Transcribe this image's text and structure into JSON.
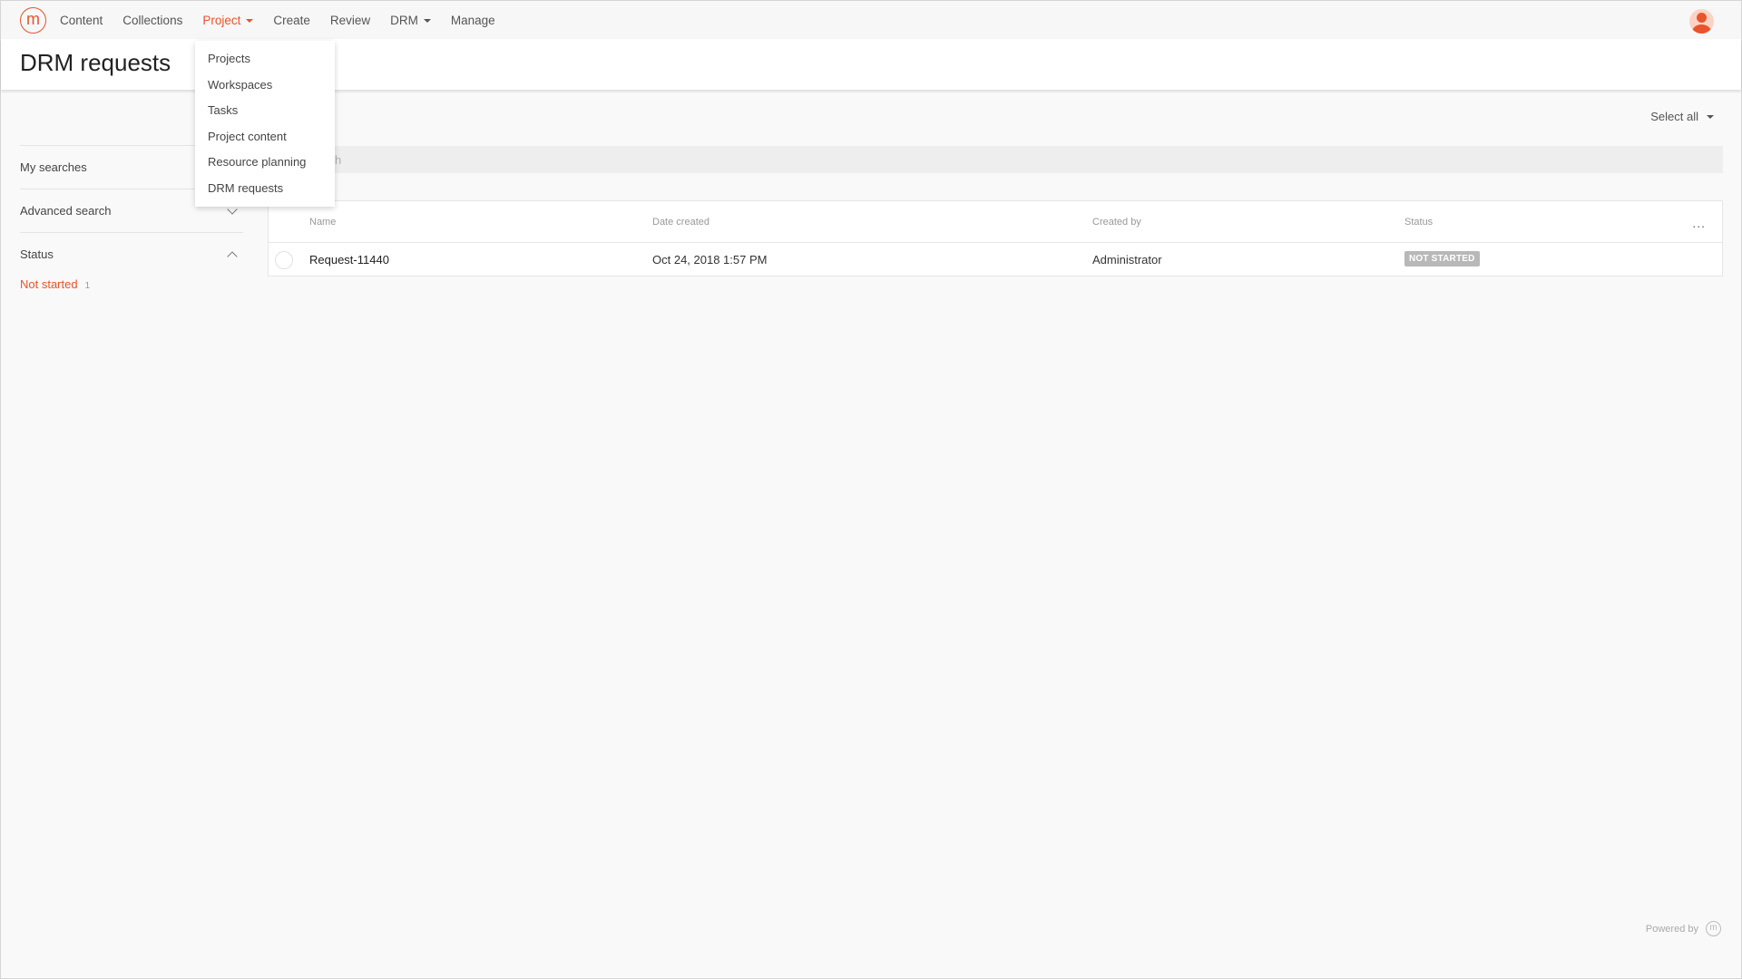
{
  "nav": {
    "logo_letter": "m",
    "items": [
      {
        "label": "Content"
      },
      {
        "label": "Collections"
      },
      {
        "label": "Project",
        "active": true,
        "has_caret": true
      },
      {
        "label": "Create"
      },
      {
        "label": "Review"
      },
      {
        "label": "DRM",
        "has_caret": true
      },
      {
        "label": "Manage"
      }
    ],
    "avatar_icon": "user-avatar-icon"
  },
  "page": {
    "title": "DRM requests"
  },
  "dropdown": {
    "items": [
      {
        "label": "Projects"
      },
      {
        "label": "Workspaces"
      },
      {
        "label": "Tasks"
      },
      {
        "label": "Project content"
      },
      {
        "label": "Resource planning"
      },
      {
        "label": "DRM requests"
      }
    ]
  },
  "sidebar": {
    "my_searches": "My searches",
    "advanced_search": "Advanced search",
    "status_label": "Status",
    "facets": [
      {
        "label": "Not started",
        "count": "1"
      }
    ]
  },
  "main": {
    "select_all": "Select all",
    "search_placeholder": "Search",
    "columns": {
      "name": "Name",
      "date_created": "Date created",
      "created_by": "Created by",
      "status": "Status"
    },
    "more": "...",
    "rows": [
      {
        "name": "Request-11440",
        "date_created": "Oct 24, 2018 1:57 PM",
        "created_by": "Administrator",
        "status": "NOT STARTED"
      }
    ]
  },
  "footer": {
    "powered_by": "Powered by",
    "logo_letter": "m"
  },
  "colors": {
    "accent": "#e8542c",
    "badge_bg": "#b8b8b8"
  }
}
